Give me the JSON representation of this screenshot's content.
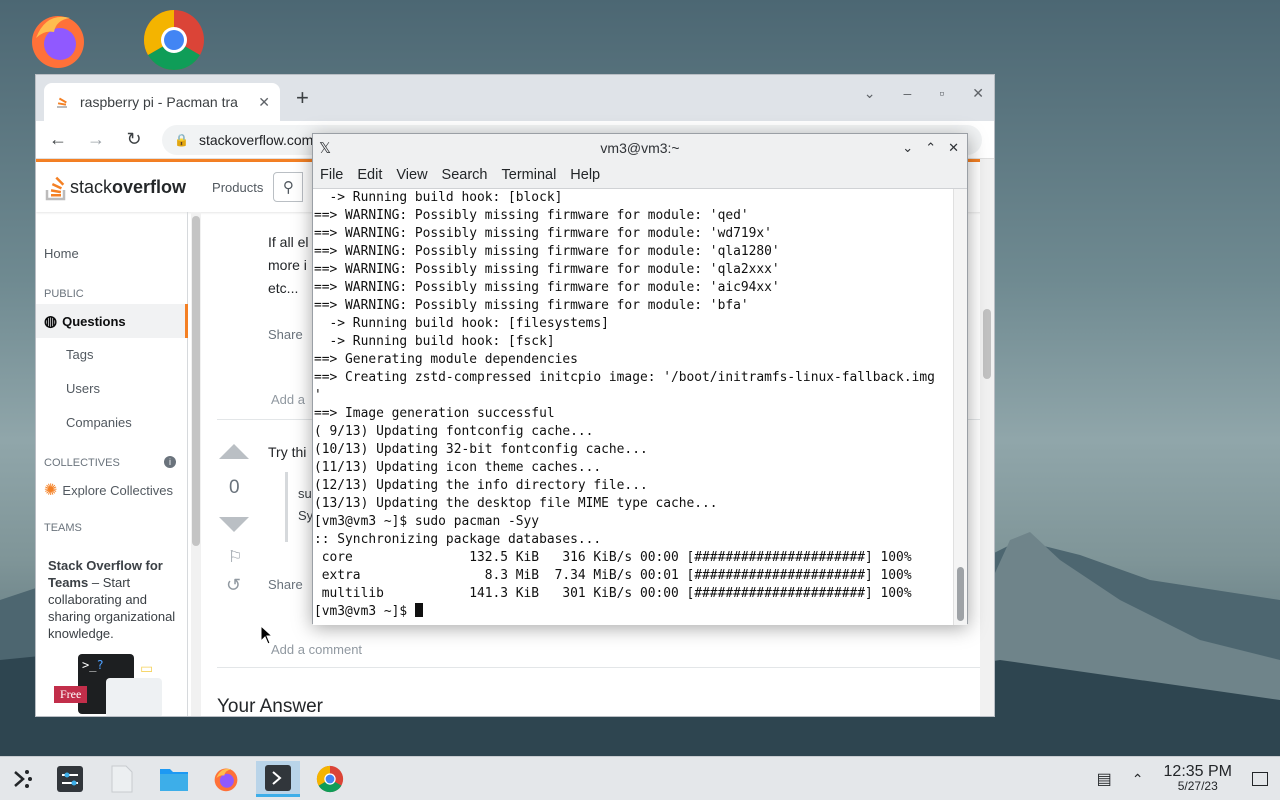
{
  "desktop": {
    "icons": [
      "firefox-icon",
      "chrome-icon"
    ]
  },
  "browser": {
    "tab_title": "raspberry pi - Pacman tra",
    "tab_close": "✕",
    "new_tab": "+",
    "url": "stackoverflow.com/qu",
    "window_controls": [
      "⌄",
      "–",
      "▫",
      "✕"
    ]
  },
  "so": {
    "logo_light": "stack",
    "logo_bold": "overflow",
    "products": "Products",
    "sidebar": {
      "home": "Home",
      "public": "PUBLIC",
      "questions": "Questions",
      "tags": "Tags",
      "users": "Users",
      "companies": "Companies",
      "collectives": "COLLECTIVES",
      "explore": "Explore Collectives",
      "teams": "TEAMS",
      "teams_title": "Stack Overflow for Teams",
      "teams_text": " – Start collaborating and sharing organizational knowledge.",
      "free_badge": "Free"
    },
    "main": {
      "line1": "If all el",
      "line2": "more i",
      "line3": "etc...",
      "share1": "Share",
      "add_comment1": "Add a",
      "try": "Try thi",
      "vote_count": "0",
      "code1": "su",
      "code2": "Sy",
      "share2": "Share",
      "add_comment2": "Add a comment",
      "your_answer": "Your Answer"
    }
  },
  "terminal": {
    "title": "vm3@vm3:~",
    "menu": [
      "File",
      "Edit",
      "View",
      "Search",
      "Terminal",
      "Help"
    ],
    "lines": [
      "  -> Running build hook: [block]",
      "==> WARNING: Possibly missing firmware for module: 'qed'",
      "==> WARNING: Possibly missing firmware for module: 'wd719x'",
      "==> WARNING: Possibly missing firmware for module: 'qla1280'",
      "==> WARNING: Possibly missing firmware for module: 'qla2xxx'",
      "==> WARNING: Possibly missing firmware for module: 'aic94xx'",
      "==> WARNING: Possibly missing firmware for module: 'bfa'",
      "  -> Running build hook: [filesystems]",
      "  -> Running build hook: [fsck]",
      "==> Generating module dependencies",
      "==> Creating zstd-compressed initcpio image: '/boot/initramfs-linux-fallback.img",
      "'",
      "==> Image generation successful",
      "( 9/13) Updating fontconfig cache...",
      "(10/13) Updating 32-bit fontconfig cache...",
      "(11/13) Updating icon theme caches...",
      "(12/13) Updating the info directory file...",
      "(13/13) Updating the desktop file MIME type cache...",
      "[vm3@vm3 ~]$ sudo pacman -Syy",
      ":: Synchronizing package databases...",
      " core               132.5 KiB   316 KiB/s 00:00 [######################] 100%",
      " extra                8.3 MiB  7.34 MiB/s 00:01 [######################] 100%",
      " multilib           141.3 KiB   301 KiB/s 00:00 [######################] 100%",
      "[vm3@vm3 ~]$ "
    ]
  },
  "taskbar": {
    "time": "12:35 PM",
    "date": "5/27/23"
  }
}
